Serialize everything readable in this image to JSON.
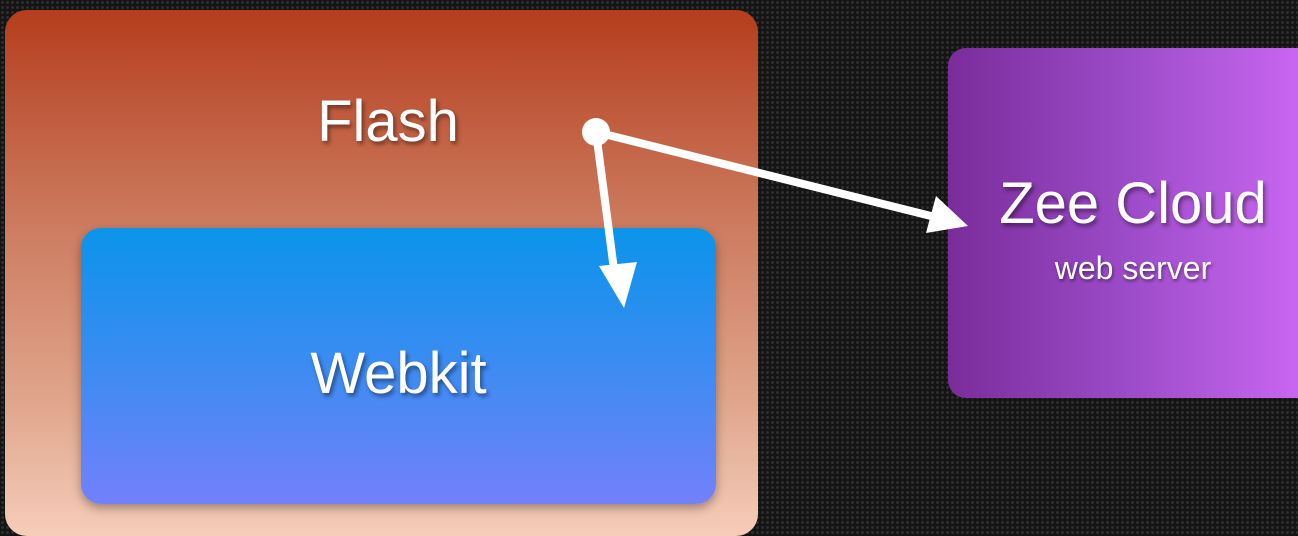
{
  "diagram": {
    "flash": {
      "label": "Flash",
      "color_top": "#b53d1d",
      "color_bottom": "#f5cdb9"
    },
    "webkit": {
      "label": "Webkit",
      "color_top": "#0a94ea",
      "color_bottom": "#7380fb"
    },
    "cloud": {
      "title": "Zee Cloud",
      "subtitle": "web server",
      "color_left": "#7a2c9a",
      "color_right": "#c866f0"
    },
    "arrow_color": "#ffffff",
    "connections": [
      {
        "from": "flash",
        "to": "webkit"
      },
      {
        "from": "flash",
        "to": "cloud"
      }
    ]
  }
}
